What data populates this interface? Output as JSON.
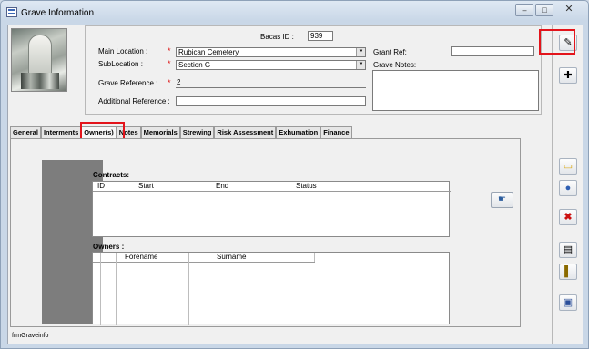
{
  "window": {
    "title": "Grave Information",
    "minimize": "–",
    "maximize": "□",
    "close": "✕"
  },
  "header": {
    "bacas_id_label": "Bacas ID :",
    "bacas_id_value": "939",
    "main_location_label": "Main Location :",
    "main_location_value": "Rubican Cemetery",
    "sublocation_label": "SubLocation :",
    "sublocation_value": "Section G",
    "grave_reference_label": "Grave Reference :",
    "grave_reference_value": "2",
    "additional_reference_label": "Additional Reference :",
    "additional_reference_value": "",
    "grant_ref_label": "Grant Ref:",
    "grant_ref_value": "",
    "grave_notes_label": "Grave Notes:",
    "required_marker": "*"
  },
  "tabs": [
    {
      "label": "General"
    },
    {
      "label": "Interments"
    },
    {
      "label": "Owner(s)"
    },
    {
      "label": "Notes"
    },
    {
      "label": "Memorials"
    },
    {
      "label": "Strewing"
    },
    {
      "label": "Risk Assessment"
    },
    {
      "label": "Exhumation"
    },
    {
      "label": "Finance"
    }
  ],
  "active_tab": "Owner(s)",
  "contracts": {
    "label": "Contracts:",
    "columns": [
      "ID",
      "Start",
      "End",
      "Status"
    ]
  },
  "owners": {
    "label": "Owners :",
    "columns": [
      "Forename",
      "Surname"
    ]
  },
  "toolbar": {
    "edit_icon": "pencil-icon",
    "new_icon": "new-record-icon",
    "open_icon": "folder-icon",
    "web_icon": "globe-icon",
    "delete_icon": "delete-icon",
    "print_icon": "printer-icon",
    "exit_icon": "exit-door-icon",
    "close_icon": "close-form-icon",
    "highlight_color": "#e3141b"
  },
  "status_bar": {
    "form_name": "frmGraveinfo"
  }
}
